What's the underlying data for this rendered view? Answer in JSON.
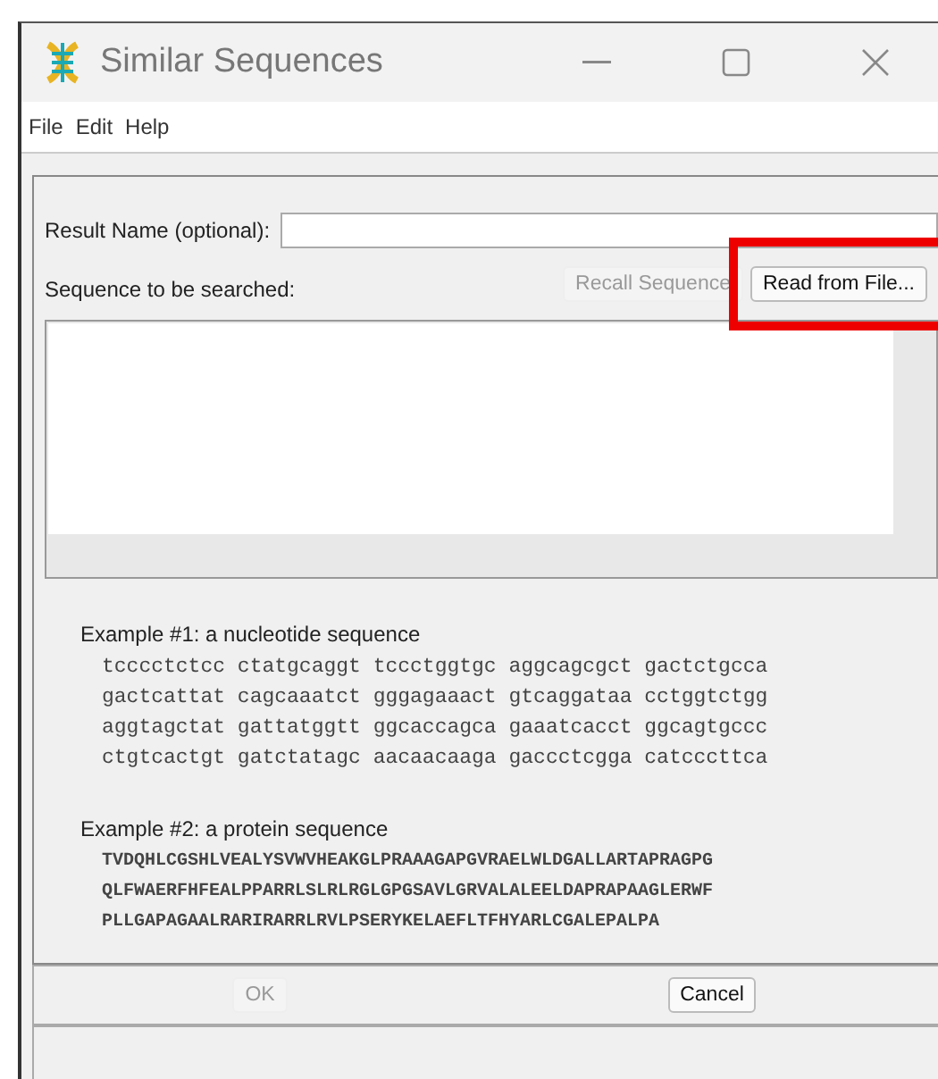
{
  "window": {
    "title": "Similar Sequences"
  },
  "menu": [
    "File",
    "Edit",
    "Help"
  ],
  "result_name": {
    "label": "Result Name (optional):"
  },
  "sequence": {
    "label": "Sequence to be searched:"
  },
  "buttons": [
    {
      "label": "Recall Sequence",
      "disabled": true,
      "highlighted": false
    },
    {
      "label": "Read from File...",
      "disabled": false,
      "highlighted": true
    }
  ],
  "examples": [
    {
      "title": "Example #1: a nucleotide sequence",
      "kind": "nucleotide",
      "lines": [
        "tcccctctcc ctatgcaggt tccctggtgc aggcagcgct gactctgcca",
        "gactcattat cagcaaatct gggagaaact gtcaggataa cctggtctgg",
        "aggtagctat gattatggtt ggcaccagca gaaatcacct ggcagtgccc",
        "ctgtcactgt gatctatagc aacaacaaga gaccctcgga catcccttca"
      ]
    },
    {
      "title": "Example #2: a protein sequence",
      "kind": "protein",
      "lines": [
        "TVDQHLCGSHLVEALYSVWVHEAKGLPRAAAGAPGVRAELWLDGALLARTAPRAGPG",
        "QLFWAERFHFEALPPARRLSLRLRGLGPGSAVLGRVALALEELDAPRAPAAGLERWF",
        "PLLGAPAGAALRARIRARRLRVLPSERYKELAEFLTFHYARLCGALEPALPA"
      ]
    }
  ],
  "dialog_buttons": [
    {
      "label": "OK",
      "disabled": true
    },
    {
      "label": "Cancel",
      "disabled": false
    }
  ]
}
